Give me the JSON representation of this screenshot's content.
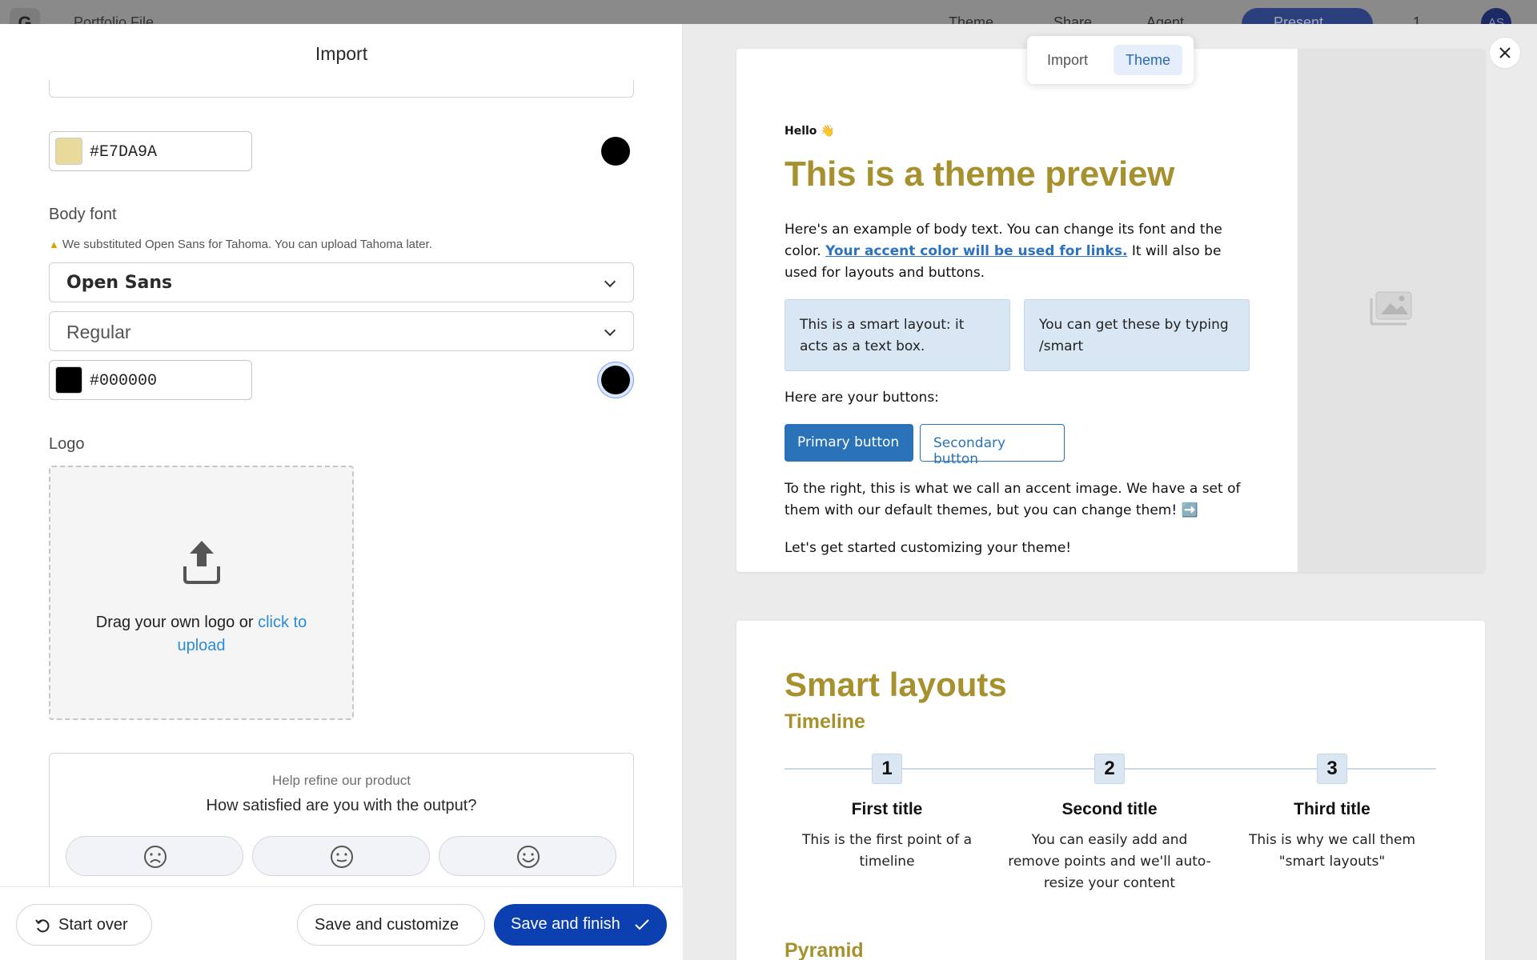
{
  "topbar": {
    "logo": "G",
    "breadcrumb": "Portfolio File",
    "theme": "Theme",
    "share": "Share",
    "agent": "Agent",
    "present": "Present",
    "comments": "1",
    "more": "...",
    "avatar": "AS"
  },
  "import_panel": {
    "title": "Import",
    "heading_color": {
      "hex": "#E7DA9A",
      "swatch": "#E7DA9A"
    },
    "body_font": {
      "label": "Body font",
      "warning": "We substituted Open Sans for Tahoma. You can upload Tahoma later.",
      "family": "Open Sans",
      "weight": "Regular",
      "color": {
        "hex": "#000000",
        "swatch": "#000000"
      }
    },
    "logo": {
      "label": "Logo",
      "drop_text": "Drag your own logo or",
      "drop_link": "click to upload"
    },
    "feedback": {
      "subtitle": "Help refine our product",
      "question": "How satisfied are you with the output?"
    },
    "footer": {
      "start_over": "Start over",
      "save_customize": "Save and customize",
      "save_finish": "Save and finish"
    }
  },
  "preview": {
    "tabs": [
      "Import",
      "Theme"
    ],
    "active_tab": "Theme",
    "card1": {
      "hello": "Hello 👋",
      "title": "This is a theme preview",
      "body_intro": "Here's an example of body text. You can change its font and the color.",
      "body_link": "Your accent color will be used for links.",
      "body_rest": "It will also be used for layouts and buttons.",
      "smart_box_1": "This is a smart layout: it acts as a text box.",
      "smart_box_2": "You can get these by typing /smart",
      "buttons_label": "Here are your buttons:",
      "primary_button": "Primary button",
      "secondary_button": "Secondary button",
      "accent_text": "To the right, this is what we call an accent image. We have a set of them with our default themes, but you can change them! ➡️",
      "start_text": "Let's get started customizing your theme!"
    },
    "card2": {
      "title": "Smart layouts",
      "subtitle": "Timeline",
      "timeline": [
        {
          "num": "1",
          "title": "First title",
          "desc": "This is the first point of a timeline"
        },
        {
          "num": "2",
          "title": "Second title",
          "desc": "You can easily add and remove points and we'll auto-resize your content"
        },
        {
          "num": "3",
          "title": "Third title",
          "desc": "This is why we call them \"smart layouts\""
        }
      ],
      "pyramid": "Pyramid"
    }
  },
  "colors": {
    "accent": "#2B73B8",
    "heading": "#A7912F",
    "primary_action": "#0C3FB0"
  }
}
